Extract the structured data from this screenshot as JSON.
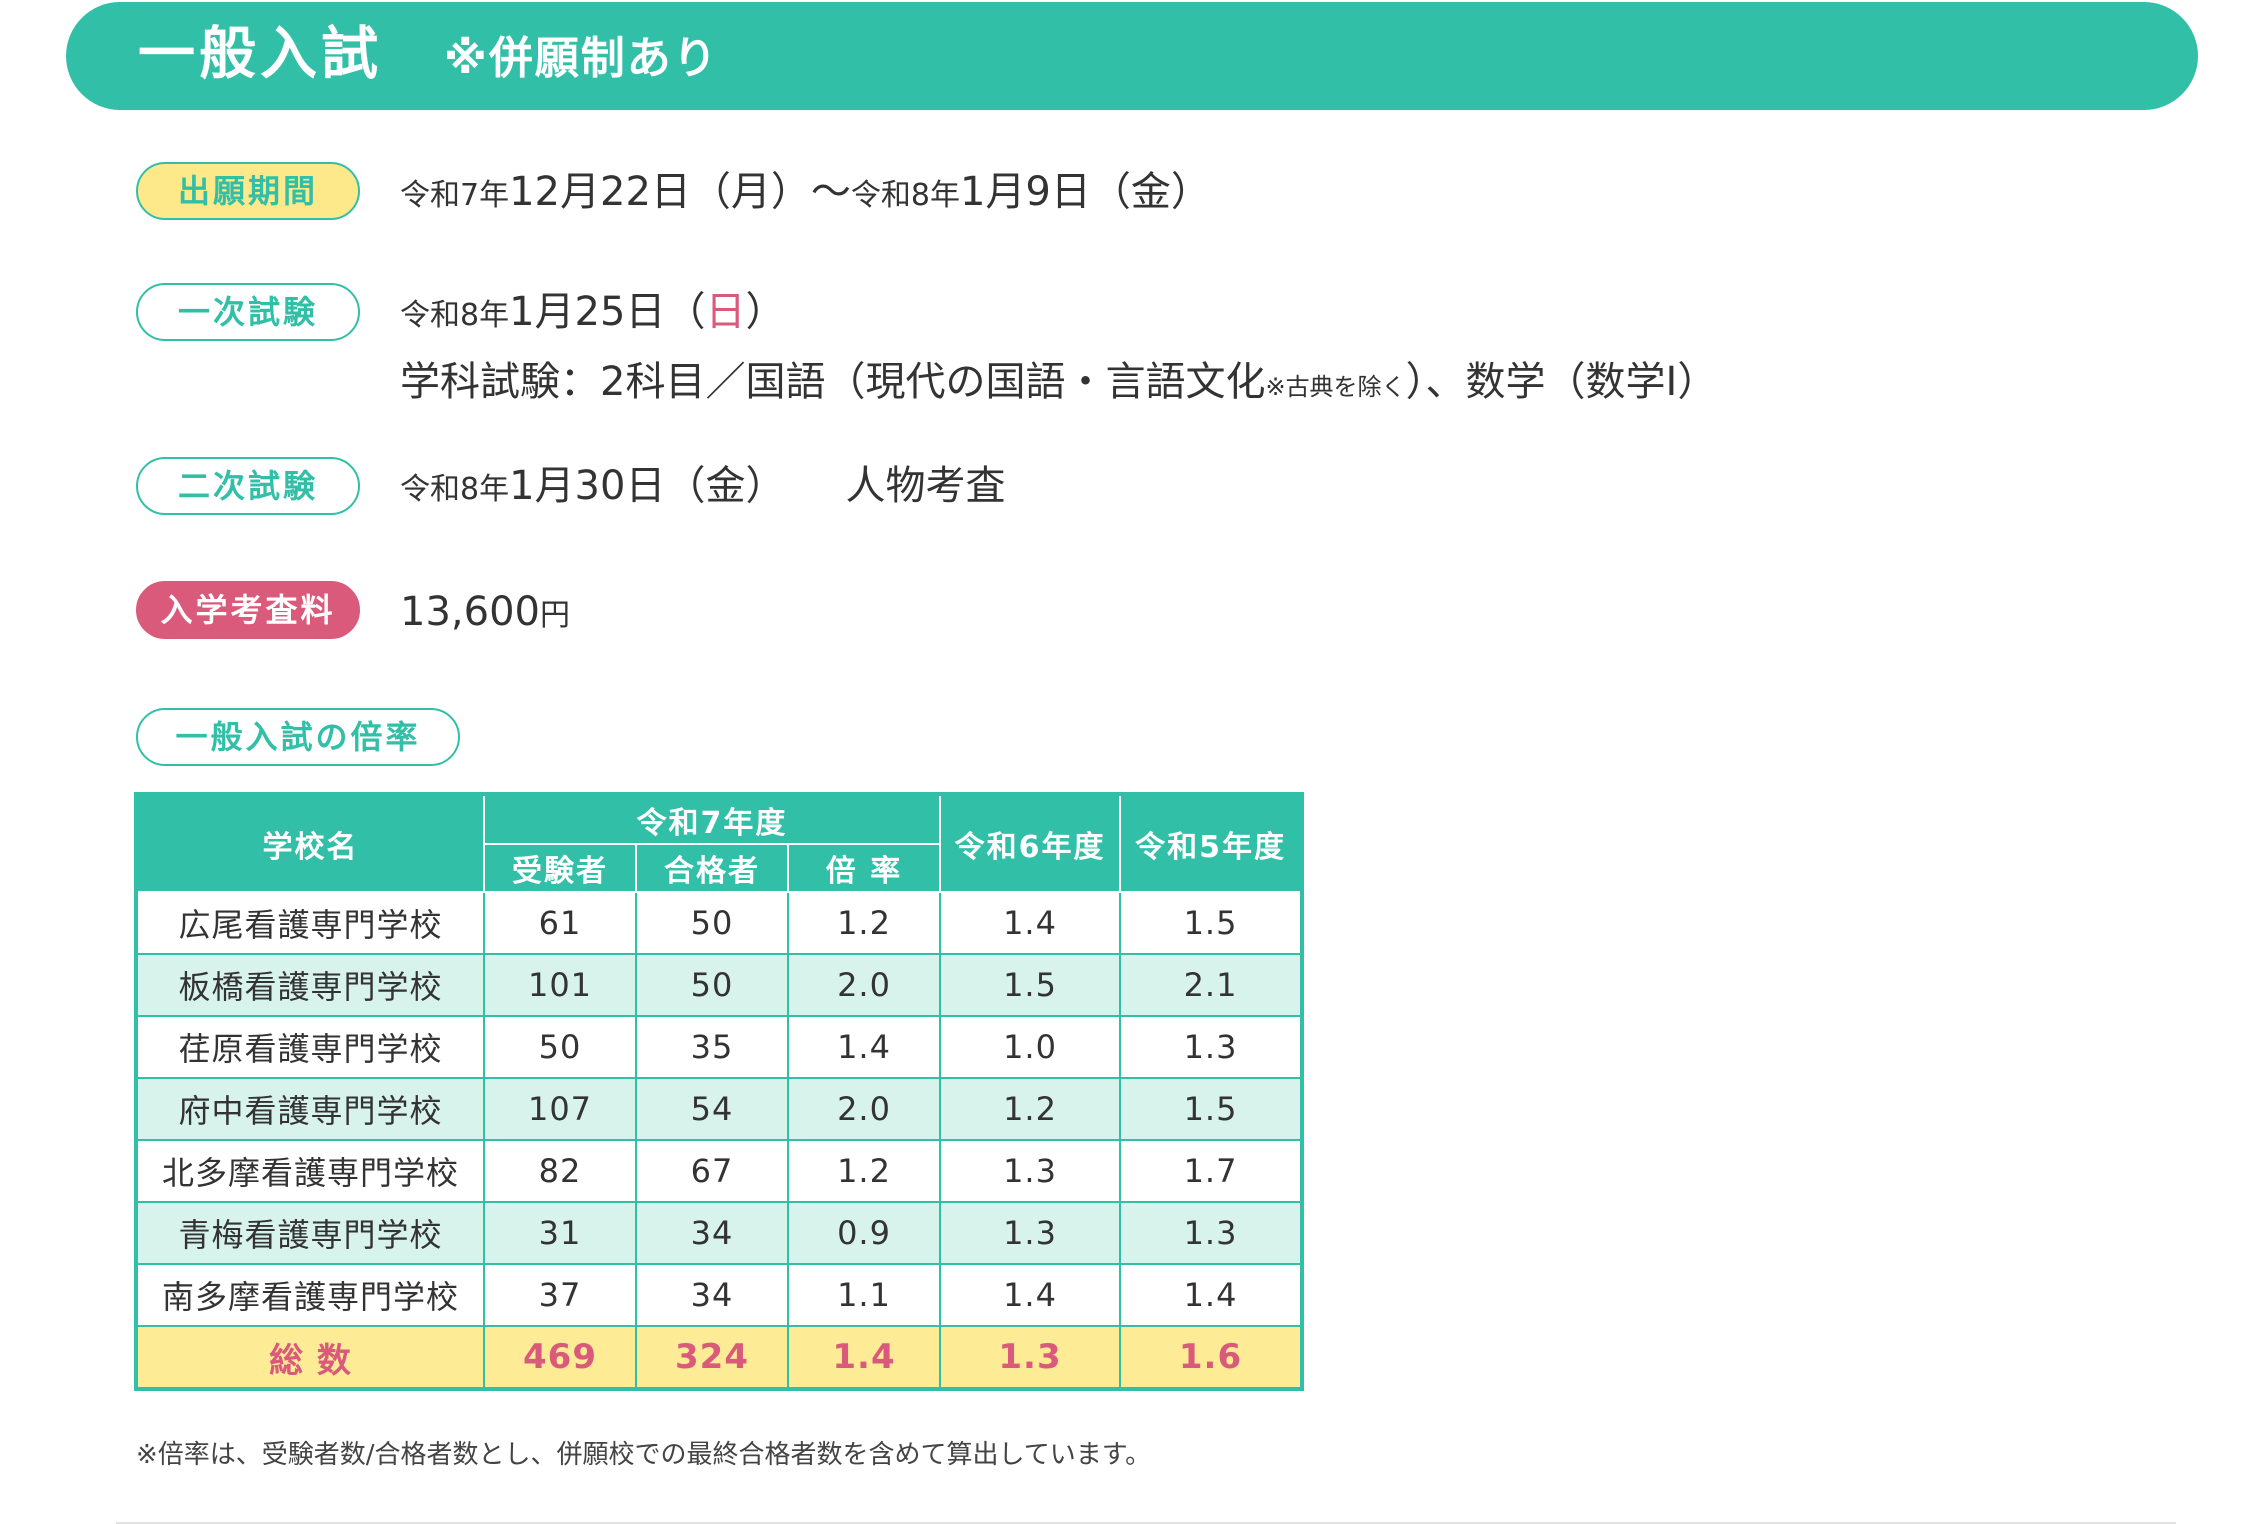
{
  "header": {
    "title": "一般入試",
    "note": "※併願制あり"
  },
  "colors": {
    "primary": "#32bfa8",
    "accent_yellow": "#fde98a",
    "accent_pink": "#d95a7b",
    "row_alt": "#d8f2ec"
  },
  "application": {
    "label": "出願期間",
    "start_era": "令和7年",
    "start_date": "12月22日（月）",
    "tilde": "〜",
    "end_era": "令和8年",
    "end_date": "1月9日（金）"
  },
  "first_exam": {
    "label": "一次試験",
    "era": "令和8年",
    "date": "1月25日（",
    "weekday": "日",
    "date_close": "）",
    "subjects_main": "学科試験：2科目／国語（現代の国語・言語文化",
    "subjects_note": "※古典を除く",
    "subjects_tail": "）、数学（数学Ⅰ）"
  },
  "second_exam": {
    "label": "二次試験",
    "era": "令和8年",
    "date": "1月30日（金）",
    "content": "人物考査"
  },
  "fee": {
    "label": "入学考査料",
    "amount": "13,600",
    "unit": "円"
  },
  "rates_section": {
    "label": "一般入試の倍率"
  },
  "rates_table": {
    "headers": {
      "school": "学校名",
      "r7": "令和7年度",
      "r7_applicants": "受験者",
      "r7_passed": "合格者",
      "r7_rate": "倍 率",
      "r6": "令和6年度",
      "r5": "令和5年度"
    },
    "rows": [
      {
        "school": "広尾看護専門学校",
        "applicants": "61",
        "passed": "50",
        "rate": "1.2",
        "r6": "1.4",
        "r5": "1.5"
      },
      {
        "school": "板橋看護専門学校",
        "applicants": "101",
        "passed": "50",
        "rate": "2.0",
        "r6": "1.5",
        "r5": "2.1"
      },
      {
        "school": "荏原看護専門学校",
        "applicants": "50",
        "passed": "35",
        "rate": "1.4",
        "r6": "1.0",
        "r5": "1.3"
      },
      {
        "school": "府中看護専門学校",
        "applicants": "107",
        "passed": "54",
        "rate": "2.0",
        "r6": "1.2",
        "r5": "1.5"
      },
      {
        "school": "北多摩看護専門学校",
        "applicants": "82",
        "passed": "67",
        "rate": "1.2",
        "r6": "1.3",
        "r5": "1.7"
      },
      {
        "school": "青梅看護専門学校",
        "applicants": "31",
        "passed": "34",
        "rate": "0.9",
        "r6": "1.3",
        "r5": "1.3"
      },
      {
        "school": "南多摩看護専門学校",
        "applicants": "37",
        "passed": "34",
        "rate": "1.1",
        "r6": "1.4",
        "r5": "1.4"
      }
    ],
    "total": {
      "school": "総 数",
      "applicants": "469",
      "passed": "324",
      "rate": "1.4",
      "r6": "1.3",
      "r5": "1.6"
    }
  },
  "footnote": "※倍率は、受験者数/合格者数とし、併願校での最終合格者数を含めて算出しています。"
}
